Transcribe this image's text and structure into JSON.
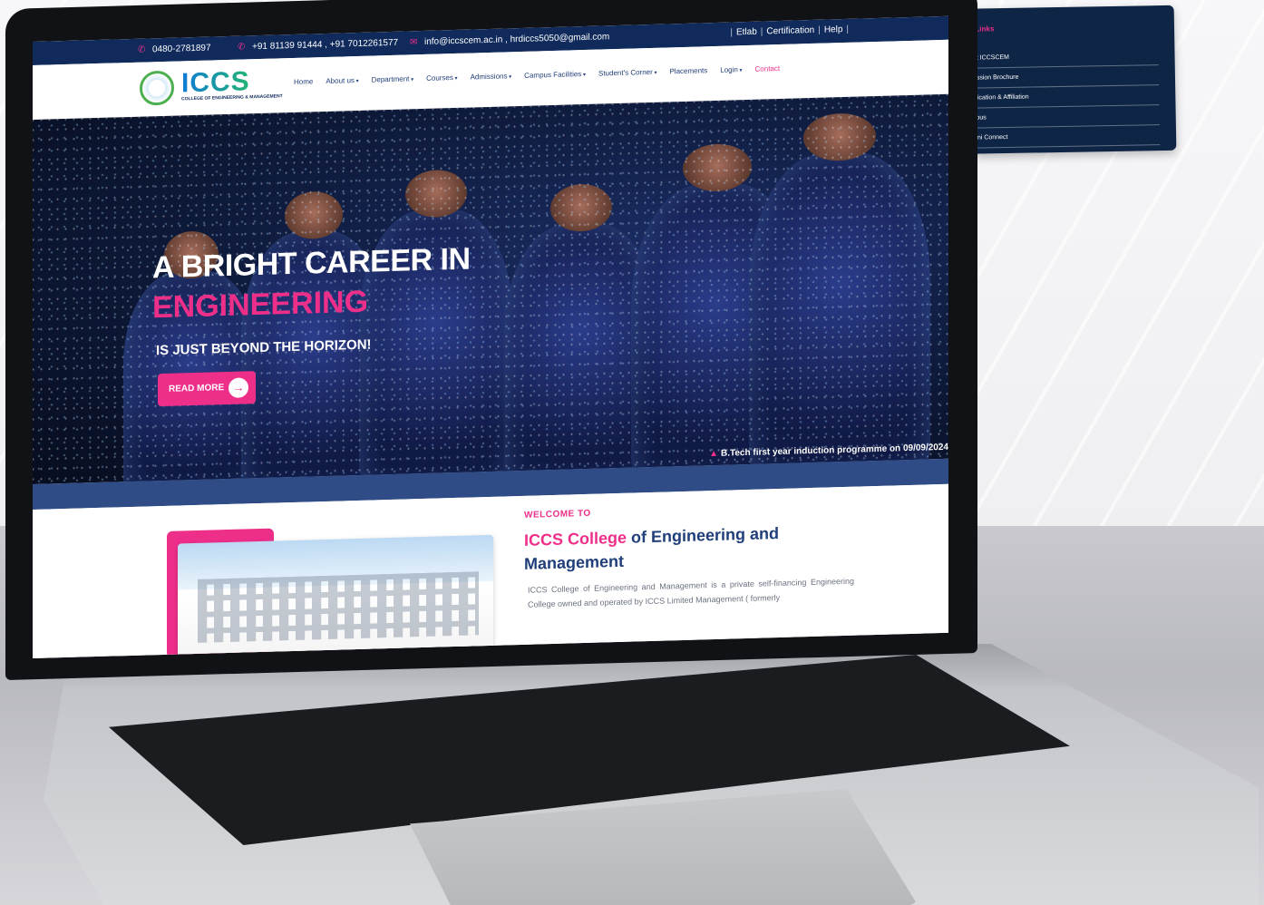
{
  "topbar": {
    "phone1": "0480-2781897",
    "phone2": "+91 81139 91444 , +91 7012261577",
    "email": "info@iccscem.ac.in , hrdiccs5050@gmail.com",
    "links": [
      "Etlab",
      "Certification",
      "Help"
    ]
  },
  "logo": {
    "brand": "ICCS",
    "subtitle": "COLLEGE OF ENGINEERING & MANAGEMENT"
  },
  "nav": {
    "items": [
      "Home",
      "About us",
      "Department",
      "Courses",
      "Admissions",
      "Campus Facilities",
      "Student's Corner",
      "Placements",
      "Login",
      "Contact"
    ]
  },
  "hero": {
    "line1": "A BRIGHT CAREER IN",
    "line2": "ENGINEERING",
    "line3": "IS JUST BEYOND THE HORIZON!",
    "button": "READ MORE"
  },
  "ticker": {
    "text": "B.Tech first year induction programme on 09/09/2024"
  },
  "welcome": {
    "label": "WELCOME TO",
    "title_highlight": "ICCS College",
    "title_rest": " of Engineering and Management",
    "paragraph": "ICCS College of Engineering and Management is a private self-financing Engineering College owned and operated by ICCS Limited Management ( formerly"
  },
  "quick_links": {
    "title": "Quick Links",
    "items": [
      "About ICCSCEM",
      "Admission Brochure",
      "Certification & Affiliation",
      "Campus",
      "Alumni Connect"
    ]
  },
  "colors": {
    "navy": "#0f2a5b",
    "accent_pink": "#ee2f8a",
    "link_blue": "#1f3e7a"
  }
}
